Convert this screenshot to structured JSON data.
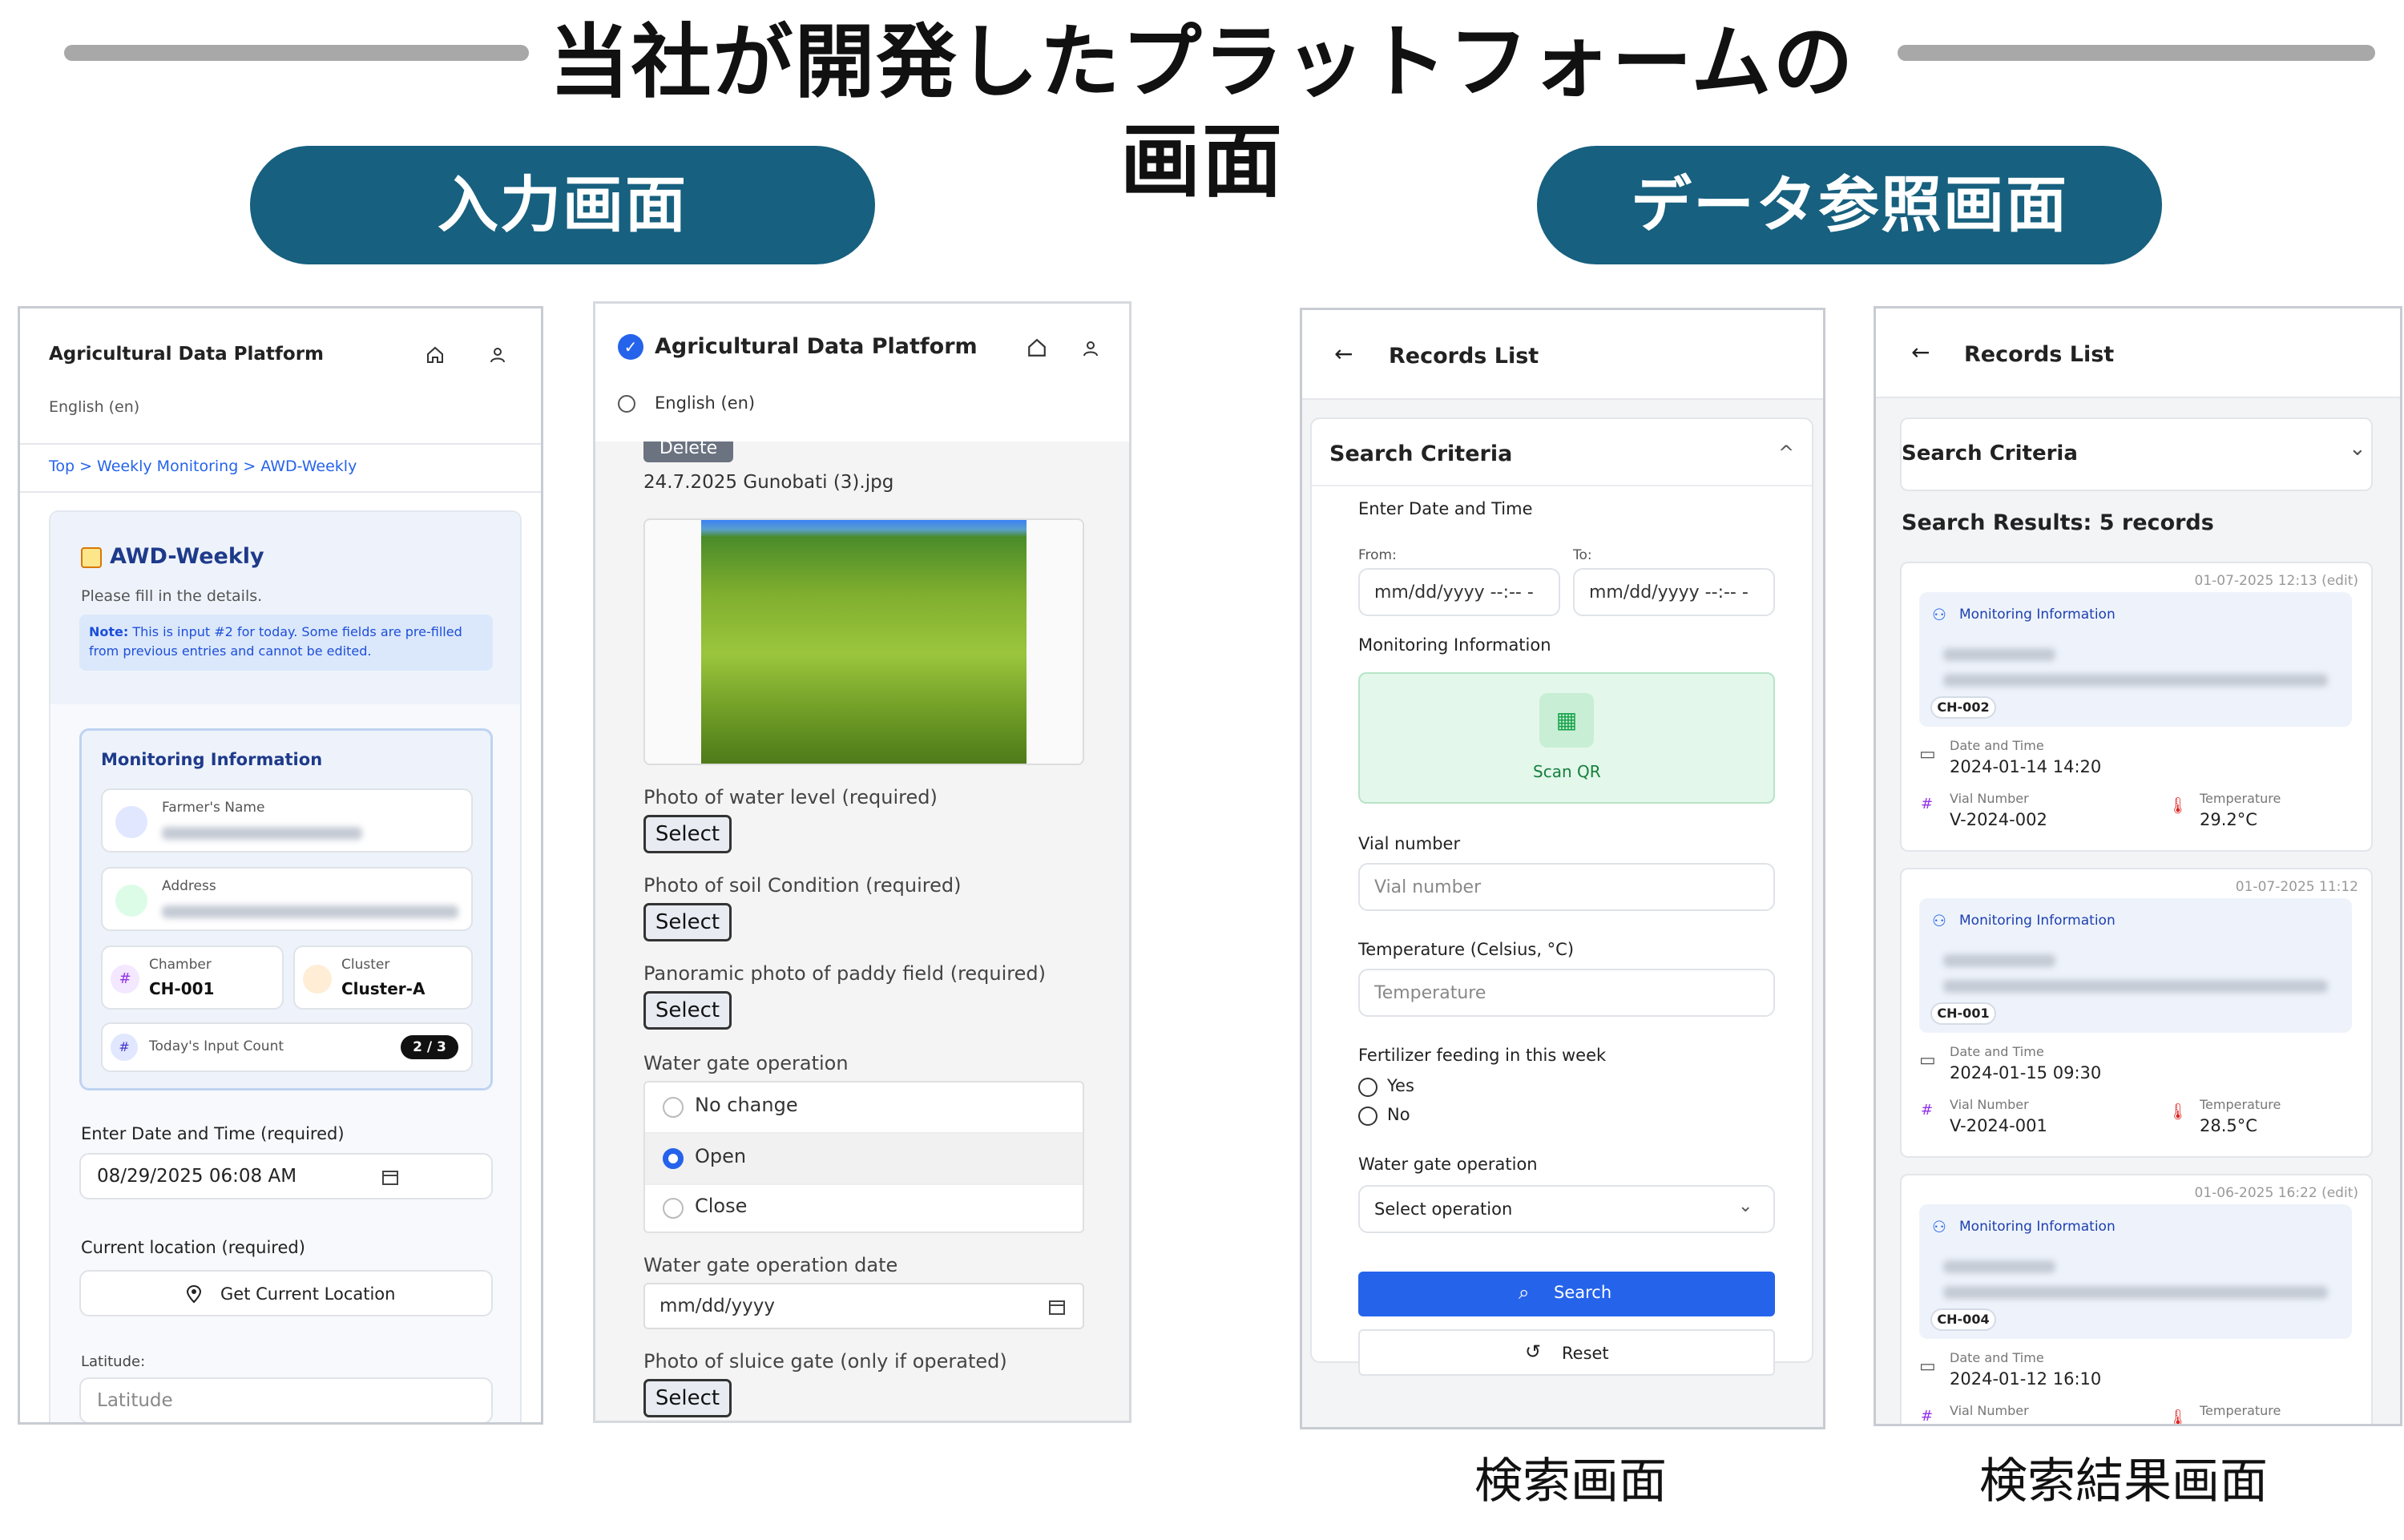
{
  "header": {
    "title": "当社が開発したプラットフォームの画面",
    "input_pill": "入力画面",
    "data_pill": "データ参照画面",
    "caption_search": "検索画面",
    "caption_results": "検索結果画面"
  },
  "p1": {
    "app_title": "Agricultural Data Platform",
    "lang": "English (en)",
    "breadcrumb": "Top > Weekly Monitoring > AWD-Weekly",
    "form_title": "AWD-Weekly",
    "subtitle": "Please fill in the details.",
    "note_bold": "Note:",
    "note_line1": "This is input #2 for today. Some fields are pre-filled",
    "note_line2": "from previous entries and cannot be edited.",
    "monitor_title": "Monitoring Information",
    "farmer_label": "Farmer's Name",
    "address_label": "Address",
    "chamber_label": "Chamber",
    "chamber_value": "CH-001",
    "cluster_label": "Cluster",
    "cluster_value": "Cluster-A",
    "count_label": "Today's Input Count",
    "count_value": "2 / 3",
    "date_label": "Enter Date and Time (required)",
    "date_value": "08/29/2025 06:08 AM",
    "location_label": "Current location (required)",
    "location_button": "Get Current Location",
    "latitude_label": "Latitude:",
    "latitude_placeholder": "Latitude"
  },
  "p2": {
    "app_title": "Agricultural Data Platform",
    "lang": "English (en)",
    "delete_label": "Delete",
    "filename": "24.7.2025 Gunobati (3).jpg",
    "water_photo_label": "Photo of water level  (required)",
    "soil_photo_label": "Photo of soil Condition  (required)",
    "panorama_label": "Panoramic photo of paddy field  (required)",
    "select_label": "Select",
    "gate_label": "Water gate operation",
    "options": [
      "No change",
      "Open",
      "Close"
    ],
    "selected_option": "Open",
    "gate_date_label": "Water gate operation date",
    "gate_date_placeholder": "mm/dd/yyyy",
    "sluice_label": "Photo of sluice gate (only if operated)"
  },
  "p3": {
    "title": "Records List",
    "criteria_title": "Search Criteria",
    "date_title": "Enter Date and Time",
    "from_label": "From:",
    "to_label": "To:",
    "date_placeholder": "mm/dd/yyyy --:-- -",
    "monitoring_label": "Monitoring Information",
    "scan_label": "Scan QR",
    "vial_label": "Vial number",
    "vial_placeholder": "Vial number",
    "temp_label": "Temperature (Celsius, °C)",
    "temp_placeholder": "Temperature",
    "fert_label": "Fertilizer feeding in this week",
    "yes_label": "Yes",
    "no_label": "No",
    "gate_label": "Water gate operation",
    "gate_select": "Select operation",
    "search_button": "Search",
    "reset_button": "Reset"
  },
  "p4": {
    "title": "Records List",
    "criteria_title": "Search Criteria",
    "results_label": "Search Results: 5 records",
    "monitoring_label": "Monitoring Information",
    "date_time_label": "Date and Time",
    "vial_label": "Vial Number",
    "temp_label": "Temperature",
    "records": [
      {
        "stamp": "01-07-2025 12:13 (edit)",
        "chamber": "CH-002",
        "datetime": "2024-01-14 14:20",
        "vial": "V-2024-002",
        "temp": "29.2°C"
      },
      {
        "stamp": "01-07-2025 11:12",
        "chamber": "CH-001",
        "datetime": "2024-01-15 09:30",
        "vial": "V-2024-001",
        "temp": "28.5°C"
      },
      {
        "stamp": "01-06-2025 16:22 (edit)",
        "chamber": "CH-004",
        "datetime": "2024-01-12 16:10",
        "vial": "Vial Number",
        "temp": "Temperature"
      }
    ]
  },
  "colors": {
    "pill": "#17607f",
    "link": "#2563eb",
    "search_button": "#2563eb",
    "scan_bg": "#e3f7ea",
    "panel_bg_blue": "#eef3fb"
  }
}
